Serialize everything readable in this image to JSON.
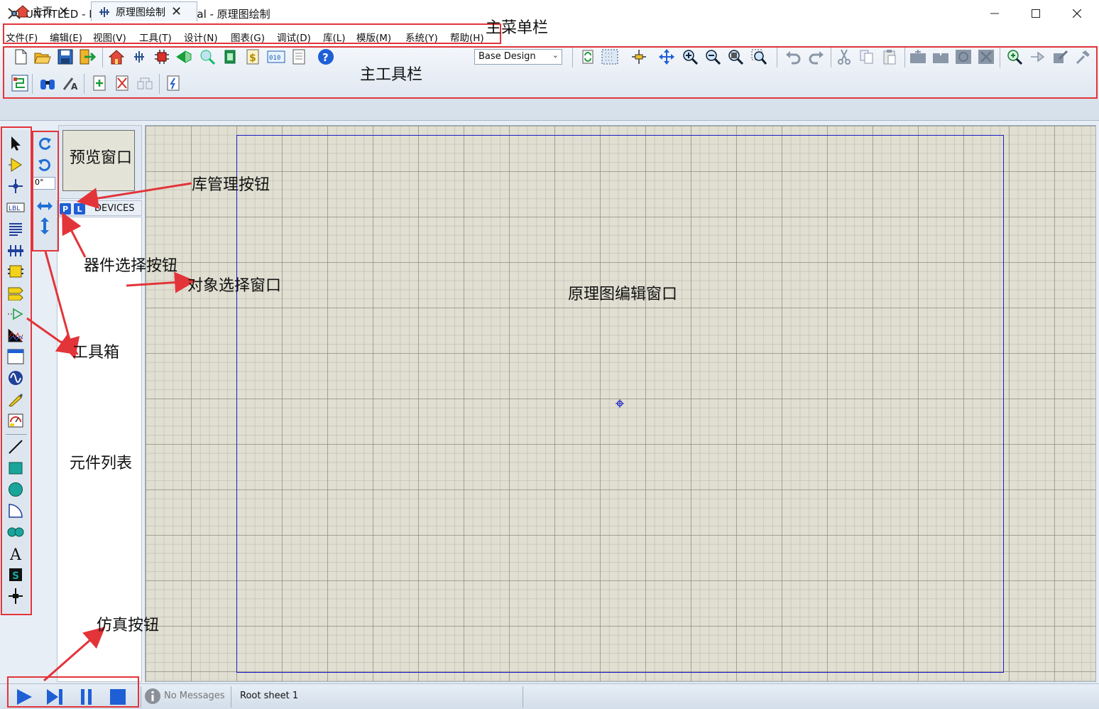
{
  "window": {
    "title": "UNTITLED - Proteus 8 Professional - 原理图绘制",
    "controls": [
      "minimize",
      "maximize",
      "close"
    ]
  },
  "menu": [
    "文件(F)",
    "编辑(E)",
    "视图(V)",
    "工具(T)",
    "设计(N)",
    "图表(G)",
    "调试(D)",
    "库(L)",
    "模版(M)",
    "系统(Y)",
    "帮助(H)"
  ],
  "toolbar": {
    "design_combo": "Base Design"
  },
  "tabs": [
    {
      "label": "主页",
      "icon": "home-icon"
    },
    {
      "label": "原理图绘制",
      "icon": "schematic-icon"
    }
  ],
  "rotation": {
    "angle": "0°"
  },
  "devices": {
    "pick_label": "P",
    "library_label": "L",
    "header": "DEVICES"
  },
  "status": {
    "messages": "No Messages",
    "sheet": "Root sheet 1"
  },
  "annotations": {
    "main_menu": "主菜单栏",
    "main_toolbar": "主工具栏",
    "preview": "预览窗口",
    "library_button": "库管理按钮",
    "device_pick_button": "器件选择按钮",
    "object_selector": "对象选择窗口",
    "toolbox": "工具箱",
    "component_list": "元件列表",
    "editor": "原理图编辑窗口",
    "sim_buttons": "仿真按钮"
  },
  "colors": {
    "annotation_red": "#e3343a",
    "sheet_border": "#1c1cc8",
    "canvas_bg": "#e0dfd2",
    "accent_blue": "#1f5fd6"
  }
}
